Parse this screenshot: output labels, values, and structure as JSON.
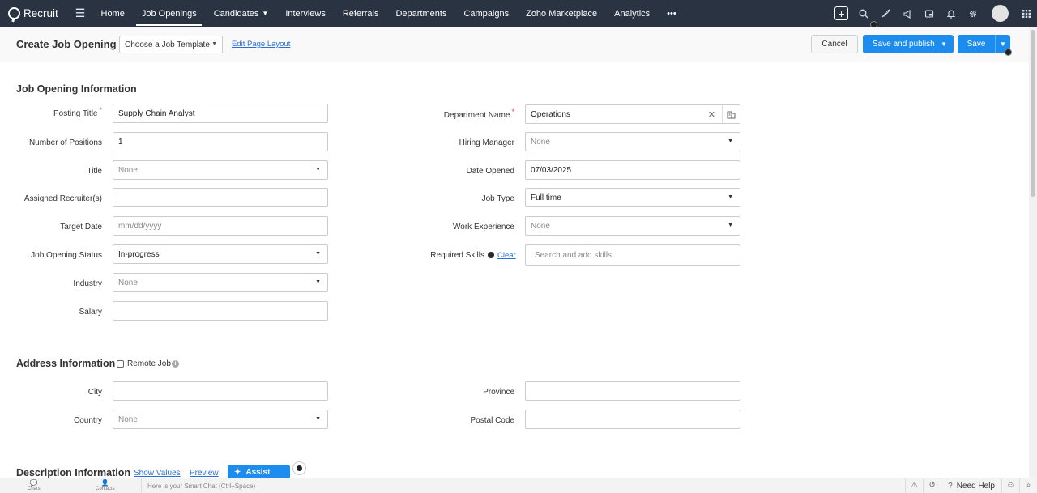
{
  "nav": {
    "brand": "Recruit",
    "links": [
      {
        "label": "Home",
        "active": false,
        "caret": ""
      },
      {
        "label": "Job Openings",
        "active": true,
        "caret": ""
      },
      {
        "label": "Candidates",
        "active": false,
        "caret": "⌄"
      },
      {
        "label": "Interviews",
        "active": false,
        "caret": ""
      },
      {
        "label": "Referrals",
        "active": false,
        "caret": ""
      },
      {
        "label": "Departments",
        "active": false,
        "caret": ""
      },
      {
        "label": "Campaigns",
        "active": false,
        "caret": ""
      },
      {
        "label": "Zoho Marketplace",
        "active": false,
        "caret": ""
      },
      {
        "label": "Analytics",
        "active": false,
        "caret": ""
      }
    ],
    "more": "•••"
  },
  "header": {
    "title": "Create Job Opening -",
    "template_select": "Choose a Job Template",
    "edit_layout": "Edit Page Layout",
    "cancel": "Cancel",
    "save_publish": "Save and publish",
    "save": "Save"
  },
  "job_info": {
    "title": "Job Opening Information",
    "left": [
      {
        "label": "Posting Title",
        "required": true,
        "value": "Supply Chain Analyst",
        "placeholder": false,
        "dropdown": false
      },
      {
        "label": "Number of Positions",
        "required": false,
        "value": "1",
        "placeholder": false,
        "dropdown": false
      },
      {
        "label": "Title",
        "required": false,
        "value": "None",
        "placeholder": true,
        "dropdown": true
      },
      {
        "label": "Assigned Recruiter(s)",
        "required": false,
        "value": "",
        "placeholder": false,
        "dropdown": false
      },
      {
        "label": "Target Date",
        "required": false,
        "value": "mm/dd/yyyy",
        "placeholder": true,
        "dropdown": false
      },
      {
        "label": "Job Opening Status",
        "required": false,
        "value": "In-progress",
        "placeholder": false,
        "dropdown": true
      },
      {
        "label": "Industry",
        "required": false,
        "value": "None",
        "placeholder": true,
        "dropdown": true
      },
      {
        "label": "Salary",
        "required": false,
        "value": "",
        "placeholder": false,
        "dropdown": false
      }
    ],
    "right": {
      "department_label": "Department Name",
      "department_value": "Operations",
      "hiring_manager_label": "Hiring Manager",
      "hiring_manager_value": "None",
      "date_opened_label": "Date Opened",
      "date_opened_value": "07/03/2025",
      "job_type_label": "Job Type",
      "job_type_value": "Full time",
      "work_exp_label": "Work Experience",
      "work_exp_value": "None",
      "skills_label": "Required Skills",
      "skills_clear": "Clear",
      "skills_placeholder": "Search and add skills"
    }
  },
  "address": {
    "title": "Address Information",
    "remote_label": "Remote Job",
    "city_label": "City",
    "country_label": "Country",
    "country_value": "None",
    "province_label": "Province",
    "postal_label": "Postal Code"
  },
  "description": {
    "title": "Description Information",
    "show_values": "Show Values",
    "preview": "Preview",
    "assist": "Assist"
  },
  "bottombar": {
    "chats": "Chats",
    "contacts": "Contacts",
    "smart_chat": "Here is your Smart Chat (Ctrl+Space)",
    "need_help": "Need Help"
  },
  "colors": {
    "nav_bg": "#2a3342",
    "primary": "#1c8cef",
    "link": "#2b6ed6",
    "required": "#e14d4d"
  }
}
